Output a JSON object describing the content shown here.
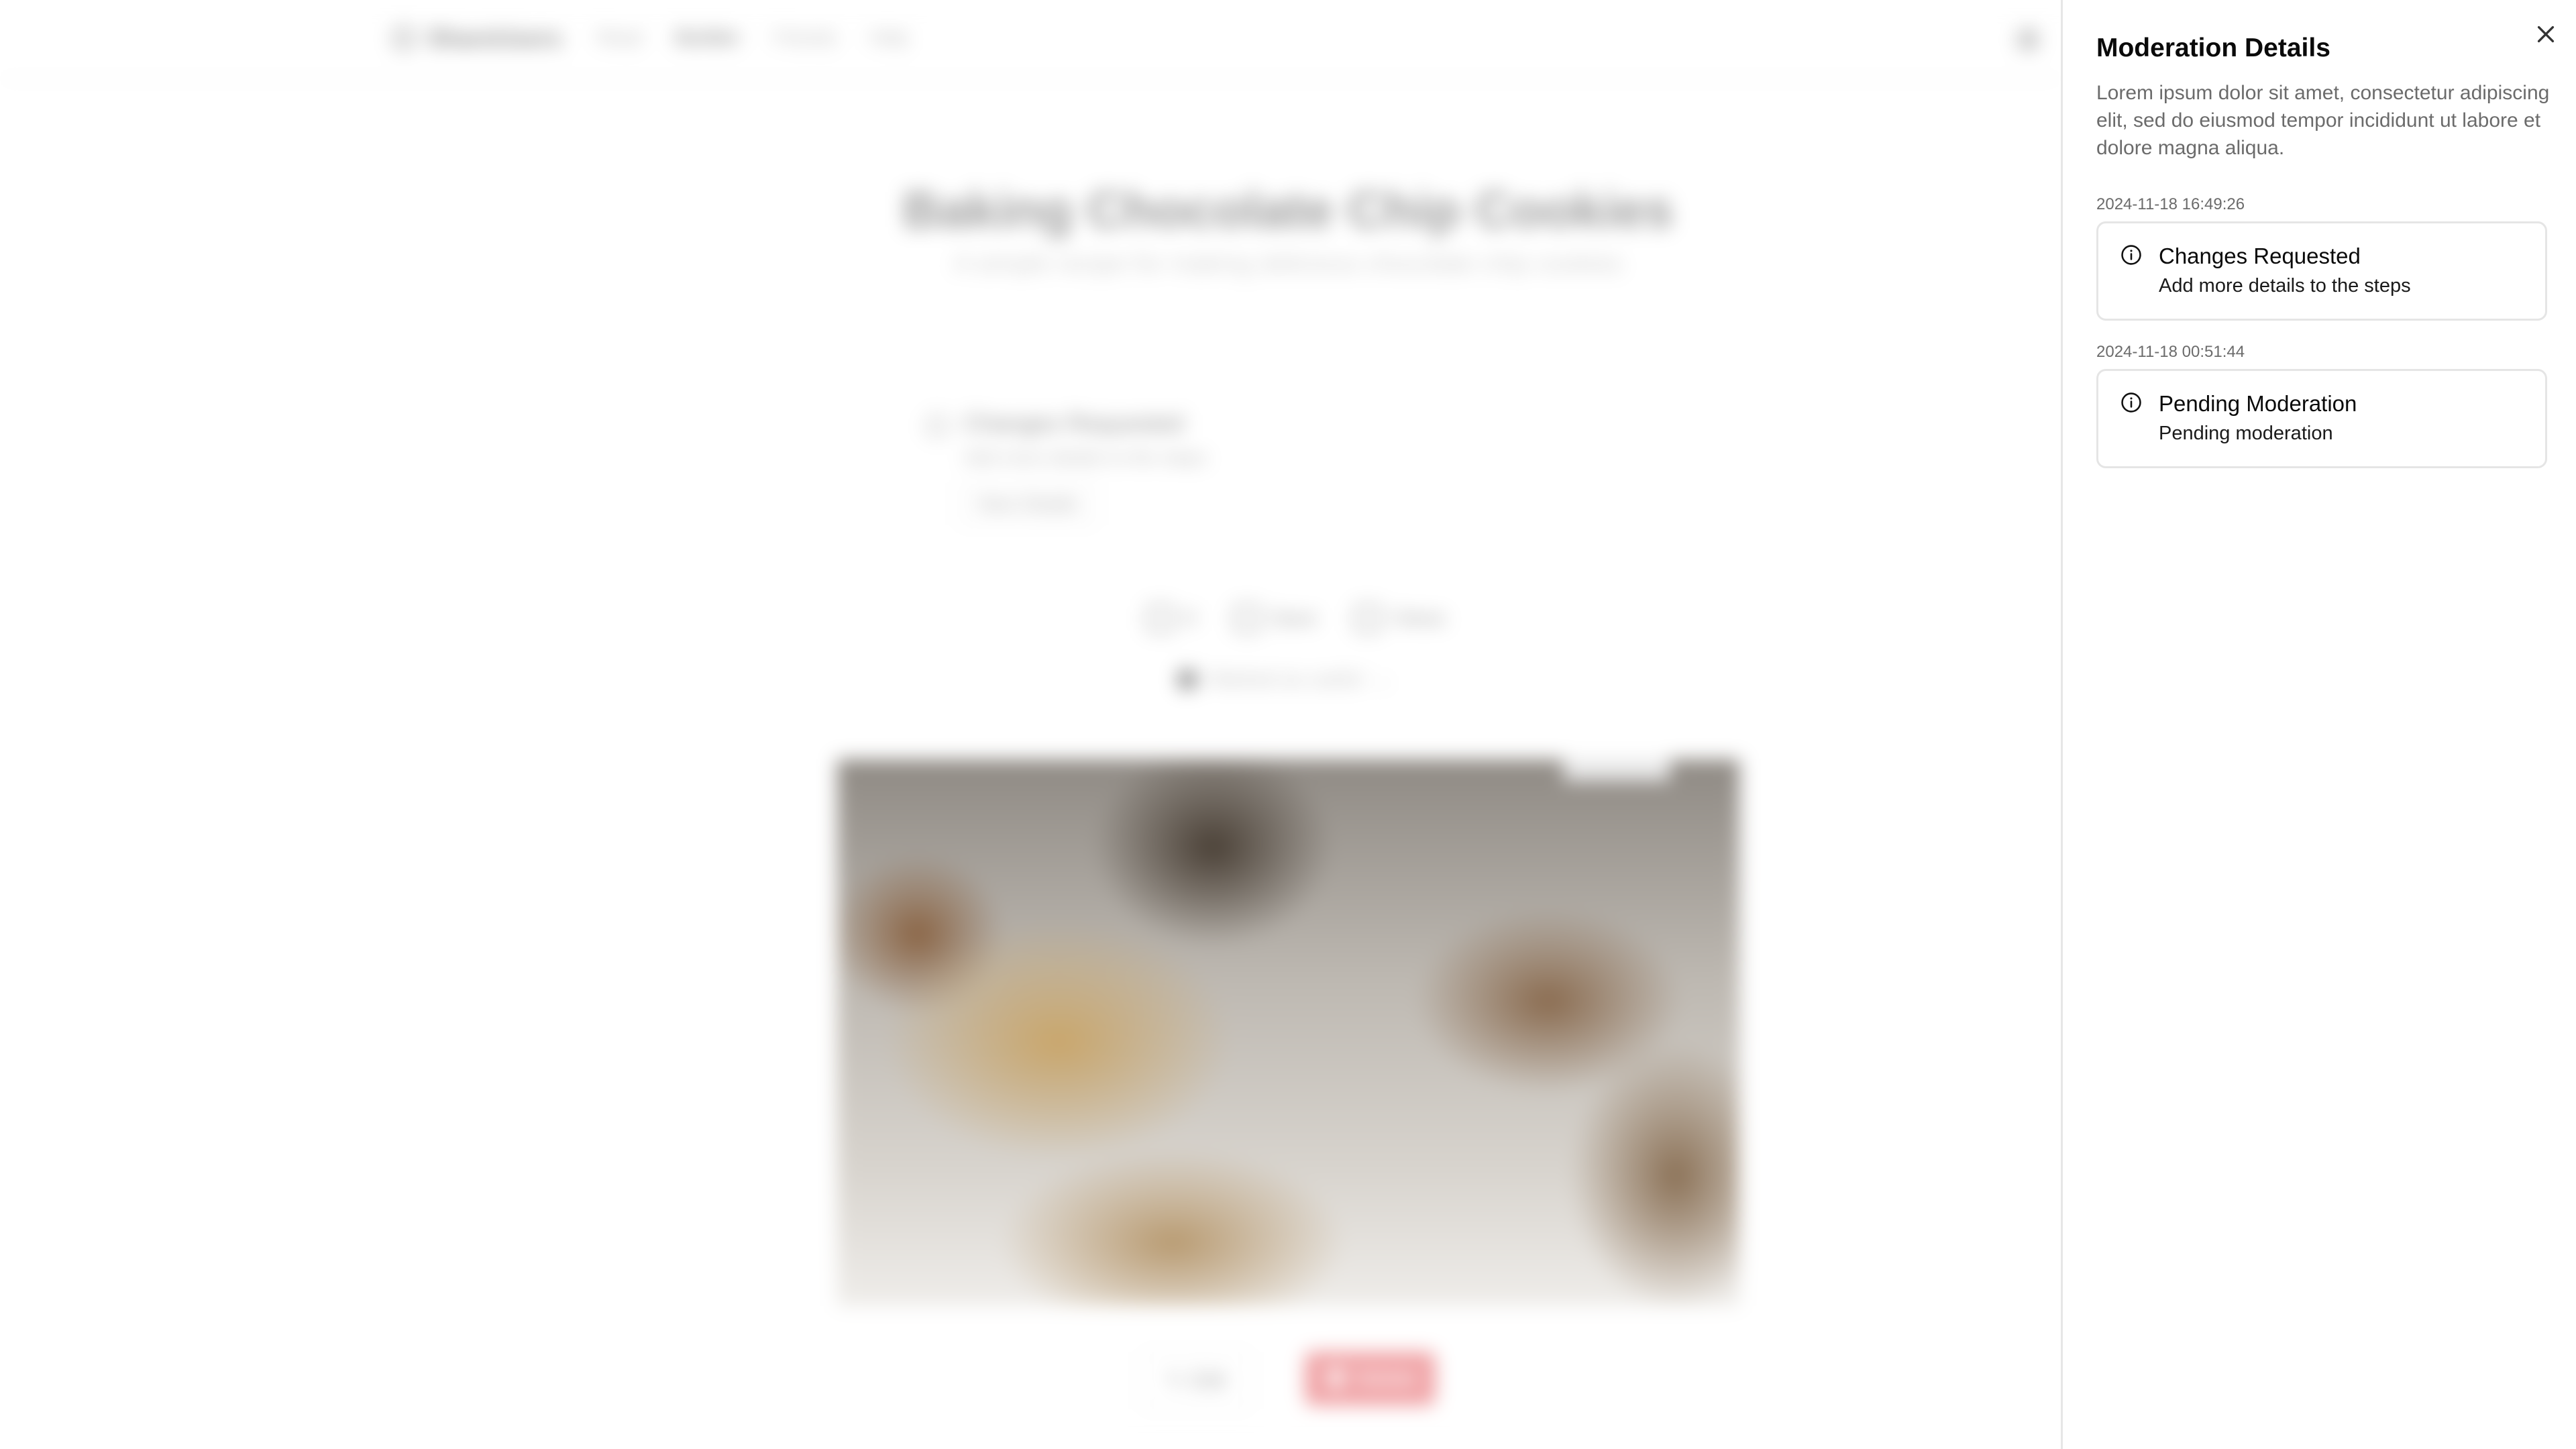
{
  "background": {
    "nav": {
      "logo_text": "ShareUsers",
      "links": [
        "Read",
        "Builder",
        "Friends",
        "Help"
      ]
    },
    "recipe": {
      "title": "Baking Chocolate Chip Cookies",
      "subtitle": "A simple recipe for making delicious chocolate chip cookies",
      "alert": {
        "title": "Changes Requested",
        "description": "Add more details to the steps",
        "button": "View Details"
      },
      "stats": {
        "comments": "0",
        "save": "Save",
        "views": "Views"
      },
      "marked": "Marked as useful",
      "image_tag": "",
      "actions": {
        "edit": "Edit",
        "delete": "Delete"
      }
    }
  },
  "sheet": {
    "title": "Moderation Details",
    "description": "Lorem ipsum dolor sit amet, consectetur adipiscing elit, sed do eiusmod tempor incididunt ut labore et dolore magna aliqua.",
    "entries": [
      {
        "timestamp": "2024-11-18 16:49:26",
        "title": "Changes Requested",
        "description": "Add more details to the steps"
      },
      {
        "timestamp": "2024-11-18 00:51:44",
        "title": "Pending Moderation",
        "description": "Pending moderation"
      }
    ],
    "close_icon": "close-icon",
    "entry_icon": "info-circle-icon"
  }
}
